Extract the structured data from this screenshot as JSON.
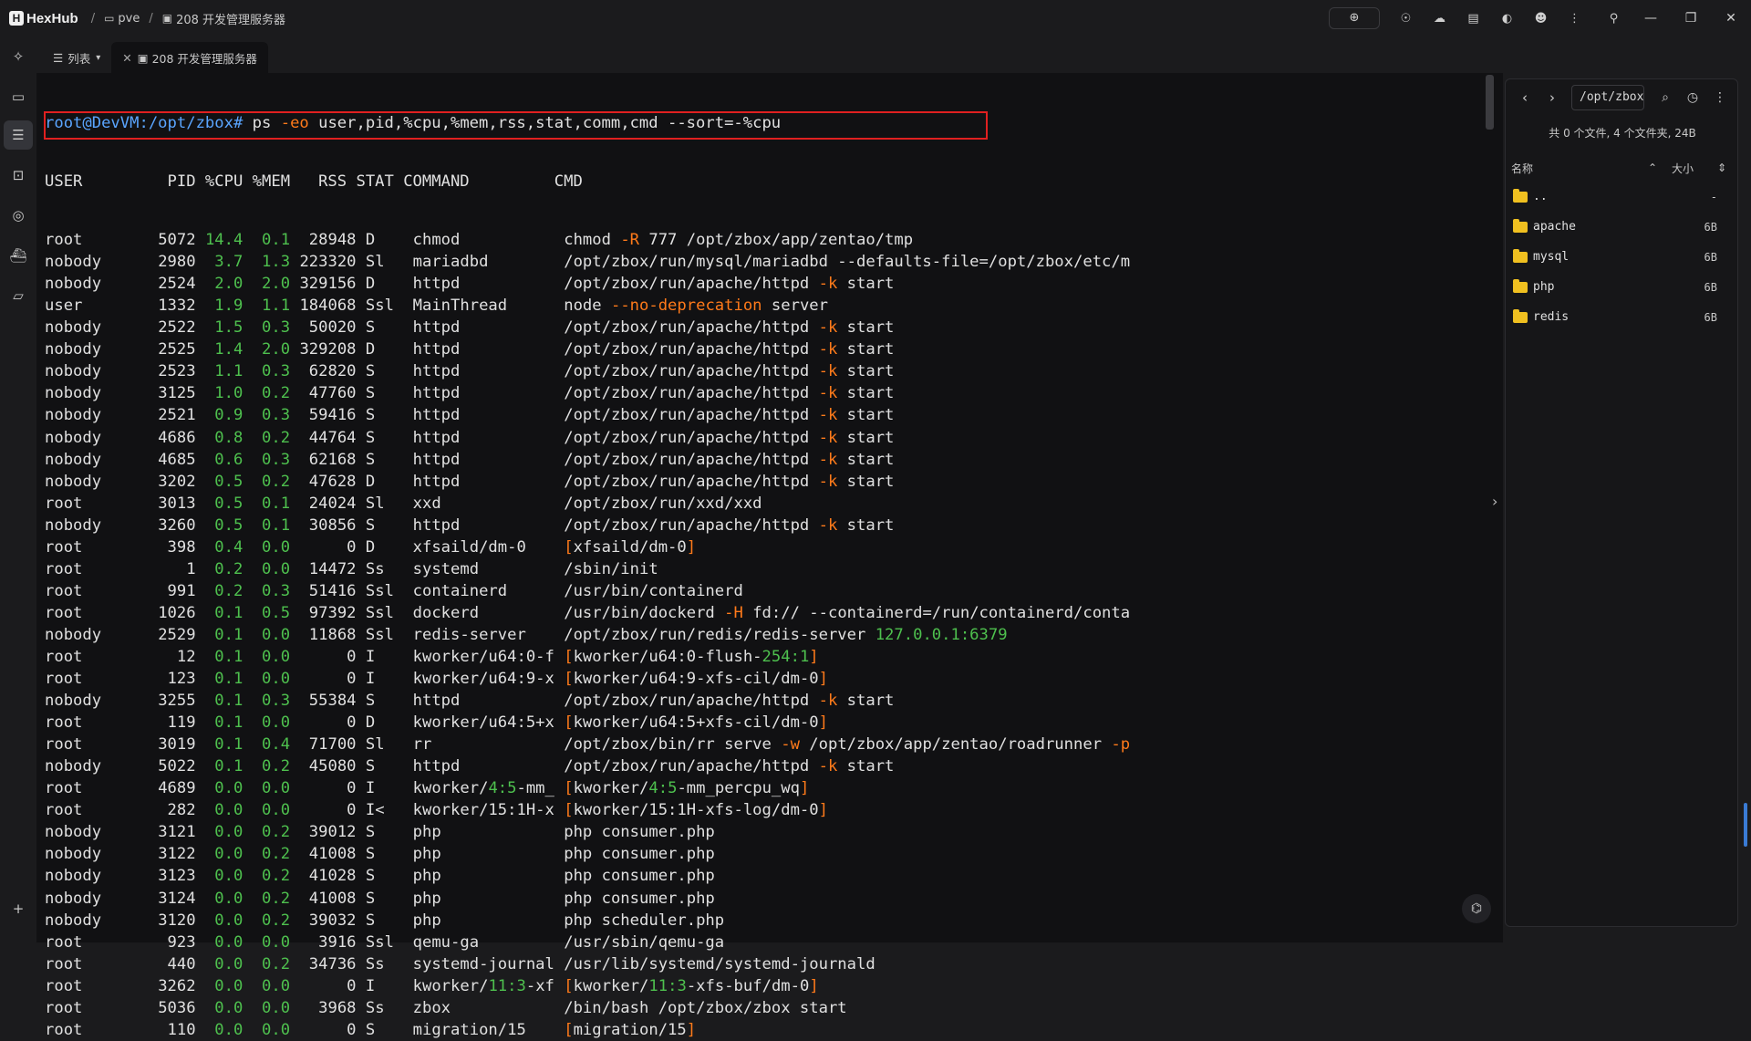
{
  "app": {
    "name": "HexHub",
    "logo_letter": "H"
  },
  "breadcrumb": {
    "sep1": "/",
    "host": "pve",
    "sep2": "/",
    "server": "208 开发管理服务器"
  },
  "tabs": {
    "list_label": "列表",
    "session_label": "208 开发管理服务器"
  },
  "terminal": {
    "prompt": "root@DevVM:/opt/zbox#",
    "command": " ps -eo user,pid,%cpu,%mem,rss,stat,comm,cmd --sort=-%cpu",
    "header": "USER         PID %CPU %MEM   RSS STAT COMMAND         CMD",
    "rows": [
      {
        "pre": "root        ",
        "pid": "5072",
        "cpu": "14.4",
        "mem": "0.1",
        "rss": "28948",
        "stat": "D   ",
        "comm": "chmod          ",
        "cmd": [
          [
            "chmod ",
            ""
          ],
          [
            "-R",
            "opt"
          ],
          [
            " 777 /opt/zbox/app/zentao/tmp",
            ""
          ]
        ]
      },
      {
        "pre": "nobody      ",
        "pid": "2980",
        "cpu": "3.7",
        "mem": "1.3",
        "rss": "223320",
        "stat": "Sl  ",
        "comm": "mariadbd       ",
        "cmd": [
          [
            "/opt/zbox/run/mysql/mariadbd --defaults-file=/opt/zbox/etc/m",
            ""
          ]
        ]
      },
      {
        "pre": "nobody      ",
        "pid": "2524",
        "cpu": "2.0",
        "mem": "2.0",
        "rss": "329156",
        "stat": "D   ",
        "comm": "httpd          ",
        "cmd": [
          [
            "/opt/zbox/run/apache/httpd ",
            ""
          ],
          [
            "-k",
            "opt"
          ],
          [
            " start",
            ""
          ]
        ]
      },
      {
        "pre": "user        ",
        "pid": "1332",
        "cpu": "1.9",
        "mem": "1.1",
        "rss": "184068",
        "stat": "Ssl ",
        "comm": "MainThread     ",
        "cmd": [
          [
            "node ",
            ""
          ],
          [
            "--no-deprecation",
            "opt"
          ],
          [
            " server",
            ""
          ]
        ]
      },
      {
        "pre": "nobody      ",
        "pid": "2522",
        "cpu": "1.5",
        "mem": "0.3",
        "rss": "50020",
        "stat": "S   ",
        "comm": "httpd          ",
        "cmd": [
          [
            "/opt/zbox/run/apache/httpd ",
            ""
          ],
          [
            "-k",
            "opt"
          ],
          [
            " start",
            ""
          ]
        ]
      },
      {
        "pre": "nobody      ",
        "pid": "2525",
        "cpu": "1.4",
        "mem": "2.0",
        "rss": "329208",
        "stat": "D   ",
        "comm": "httpd          ",
        "cmd": [
          [
            "/opt/zbox/run/apache/httpd ",
            ""
          ],
          [
            "-k",
            "opt"
          ],
          [
            " start",
            ""
          ]
        ]
      },
      {
        "pre": "nobody      ",
        "pid": "2523",
        "cpu": "1.1",
        "mem": "0.3",
        "rss": "62820",
        "stat": "S   ",
        "comm": "httpd          ",
        "cmd": [
          [
            "/opt/zbox/run/apache/httpd ",
            ""
          ],
          [
            "-k",
            "opt"
          ],
          [
            " start",
            ""
          ]
        ]
      },
      {
        "pre": "nobody      ",
        "pid": "3125",
        "cpu": "1.0",
        "mem": "0.2",
        "rss": "47760",
        "stat": "S   ",
        "comm": "httpd          ",
        "cmd": [
          [
            "/opt/zbox/run/apache/httpd ",
            ""
          ],
          [
            "-k",
            "opt"
          ],
          [
            " start",
            ""
          ]
        ]
      },
      {
        "pre": "nobody      ",
        "pid": "2521",
        "cpu": "0.9",
        "mem": "0.3",
        "rss": "59416",
        "stat": "S   ",
        "comm": "httpd          ",
        "cmd": [
          [
            "/opt/zbox/run/apache/httpd ",
            ""
          ],
          [
            "-k",
            "opt"
          ],
          [
            " start",
            ""
          ]
        ]
      },
      {
        "pre": "nobody      ",
        "pid": "4686",
        "cpu": "0.8",
        "mem": "0.2",
        "rss": "44764",
        "stat": "S   ",
        "comm": "httpd          ",
        "cmd": [
          [
            "/opt/zbox/run/apache/httpd ",
            ""
          ],
          [
            "-k",
            "opt"
          ],
          [
            " start",
            ""
          ]
        ]
      },
      {
        "pre": "nobody      ",
        "pid": "4685",
        "cpu": "0.6",
        "mem": "0.3",
        "rss": "62168",
        "stat": "S   ",
        "comm": "httpd          ",
        "cmd": [
          [
            "/opt/zbox/run/apache/httpd ",
            ""
          ],
          [
            "-k",
            "opt"
          ],
          [
            " start",
            ""
          ]
        ]
      },
      {
        "pre": "nobody      ",
        "pid": "3202",
        "cpu": "0.5",
        "mem": "0.2",
        "rss": "47628",
        "stat": "D   ",
        "comm": "httpd          ",
        "cmd": [
          [
            "/opt/zbox/run/apache/httpd ",
            ""
          ],
          [
            "-k",
            "opt"
          ],
          [
            " start",
            ""
          ]
        ]
      },
      {
        "pre": "root        ",
        "pid": "3013",
        "cpu": "0.5",
        "mem": "0.1",
        "rss": "24024",
        "stat": "Sl  ",
        "comm": "xxd            ",
        "cmd": [
          [
            "/opt/zbox/run/xxd/xxd",
            ""
          ]
        ]
      },
      {
        "pre": "nobody      ",
        "pid": "3260",
        "cpu": "0.5",
        "mem": "0.1",
        "rss": "30856",
        "stat": "S   ",
        "comm": "httpd          ",
        "cmd": [
          [
            "/opt/zbox/run/apache/httpd ",
            ""
          ],
          [
            "-k",
            "opt"
          ],
          [
            " start",
            ""
          ]
        ]
      },
      {
        "pre": "root        ",
        "pid": "398",
        "cpu": "0.4",
        "mem": "0.0",
        "rss": "0",
        "stat": "D   ",
        "comm": "xfsaild/dm-0   ",
        "cmd": [
          [
            "[",
            "opt"
          ],
          [
            "xfsaild/dm-0",
            ""
          ],
          [
            "]",
            "opt"
          ]
        ]
      },
      {
        "pre": "root        ",
        "pid": "1",
        "cpu": "0.2",
        "mem": "0.0",
        "rss": "14472",
        "stat": "Ss  ",
        "comm": "systemd        ",
        "cmd": [
          [
            "/sbin/init",
            ""
          ]
        ]
      },
      {
        "pre": "root        ",
        "pid": "991",
        "cpu": "0.2",
        "mem": "0.3",
        "rss": "51416",
        "stat": "Ssl ",
        "comm": "containerd     ",
        "cmd": [
          [
            "/usr/bin/containerd",
            ""
          ]
        ]
      },
      {
        "pre": "root        ",
        "pid": "1026",
        "cpu": "0.1",
        "mem": "0.5",
        "rss": "97392",
        "stat": "Ssl ",
        "comm": "dockerd        ",
        "cmd": [
          [
            "/usr/bin/dockerd ",
            ""
          ],
          [
            "-H",
            "opt"
          ],
          [
            " fd:// --containerd=/run/containerd/conta",
            ""
          ]
        ]
      },
      {
        "pre": "nobody      ",
        "pid": "2529",
        "cpu": "0.1",
        "mem": "0.0",
        "rss": "11868",
        "stat": "Ssl ",
        "comm": "redis-server   ",
        "cmd": [
          [
            "/opt/zbox/run/redis/redis-server ",
            ""
          ],
          [
            "127.0.0.1:6379",
            "num"
          ]
        ]
      },
      {
        "pre": "root        ",
        "pid": "12",
        "cpu": "0.1",
        "mem": "0.0",
        "rss": "0",
        "stat": "I   ",
        "comm": "kworker/u64:0-f",
        "cmd": [
          [
            "[",
            "opt"
          ],
          [
            "kworker/u64:0-flush-",
            ""
          ],
          [
            "254:1",
            "num"
          ],
          [
            "]",
            "opt"
          ]
        ]
      },
      {
        "pre": "root        ",
        "pid": "123",
        "cpu": "0.1",
        "mem": "0.0",
        "rss": "0",
        "stat": "I   ",
        "comm": "kworker/u64:9-x",
        "cmd": [
          [
            "[",
            "opt"
          ],
          [
            "kworker/u64:9-xfs-cil/dm-0",
            ""
          ],
          [
            "]",
            "opt"
          ]
        ]
      },
      {
        "pre": "nobody      ",
        "pid": "3255",
        "cpu": "0.1",
        "mem": "0.3",
        "rss": "55384",
        "stat": "S   ",
        "comm": "httpd          ",
        "cmd": [
          [
            "/opt/zbox/run/apache/httpd ",
            ""
          ],
          [
            "-k",
            "opt"
          ],
          [
            " start",
            ""
          ]
        ]
      },
      {
        "pre": "root        ",
        "pid": "119",
        "cpu": "0.1",
        "mem": "0.0",
        "rss": "0",
        "stat": "D   ",
        "comm": "kworker/u64:5+x",
        "cmd": [
          [
            "[",
            "opt"
          ],
          [
            "kworker/u64:5+xfs-cil/dm-0",
            ""
          ],
          [
            "]",
            "opt"
          ]
        ]
      },
      {
        "pre": "root        ",
        "pid": "3019",
        "cpu": "0.1",
        "mem": "0.4",
        "rss": "71700",
        "stat": "Sl  ",
        "comm": "rr             ",
        "cmd": [
          [
            "/opt/zbox/bin/rr serve ",
            ""
          ],
          [
            "-w",
            "opt"
          ],
          [
            " /opt/zbox/app/zentao/roadrunner ",
            ""
          ],
          [
            "-p",
            "opt"
          ]
        ]
      },
      {
        "pre": "nobody      ",
        "pid": "5022",
        "cpu": "0.1",
        "mem": "0.2",
        "rss": "45080",
        "stat": "S   ",
        "comm": "httpd          ",
        "cmd": [
          [
            "/opt/zbox/run/apache/httpd ",
            ""
          ],
          [
            "-k",
            "opt"
          ],
          [
            " start",
            ""
          ]
        ]
      },
      {
        "pre": "root        ",
        "pid": "4689",
        "cpu": "0.0",
        "mem": "0.0",
        "rss": "0",
        "stat": "I   ",
        "comm": "kworker/4:5-mm_",
        "comm_num": "4:5",
        "cmd": [
          [
            "[",
            "opt"
          ],
          [
            "kworker/",
            ""
          ],
          [
            "4:5",
            "num"
          ],
          [
            "-mm_percpu_wq",
            ""
          ],
          [
            "]",
            "opt"
          ]
        ]
      },
      {
        "pre": "root        ",
        "pid": "282",
        "cpu": "0.0",
        "mem": "0.0",
        "rss": "0",
        "stat": "I<  ",
        "comm": "kworker/15:1H-x",
        "cmd": [
          [
            "[",
            "opt"
          ],
          [
            "kworker/15:1H-xfs-log/dm-0",
            ""
          ],
          [
            "]",
            "opt"
          ]
        ]
      },
      {
        "pre": "nobody      ",
        "pid": "3121",
        "cpu": "0.0",
        "mem": "0.2",
        "rss": "39012",
        "stat": "S   ",
        "comm": "php            ",
        "cmd": [
          [
            "php consumer.php",
            ""
          ]
        ]
      },
      {
        "pre": "nobody      ",
        "pid": "3122",
        "cpu": "0.0",
        "mem": "0.2",
        "rss": "41008",
        "stat": "S   ",
        "comm": "php            ",
        "cmd": [
          [
            "php consumer.php",
            ""
          ]
        ]
      },
      {
        "pre": "nobody      ",
        "pid": "3123",
        "cpu": "0.0",
        "mem": "0.2",
        "rss": "41028",
        "stat": "S   ",
        "comm": "php            ",
        "cmd": [
          [
            "php consumer.php",
            ""
          ]
        ]
      },
      {
        "pre": "nobody      ",
        "pid": "3124",
        "cpu": "0.0",
        "mem": "0.2",
        "rss": "41008",
        "stat": "S   ",
        "comm": "php            ",
        "cmd": [
          [
            "php consumer.php",
            ""
          ]
        ]
      },
      {
        "pre": "nobody      ",
        "pid": "3120",
        "cpu": "0.0",
        "mem": "0.2",
        "rss": "39032",
        "stat": "S   ",
        "comm": "php            ",
        "cmd": [
          [
            "php scheduler.php",
            ""
          ]
        ]
      },
      {
        "pre": "root        ",
        "pid": "923",
        "cpu": "0.0",
        "mem": "0.0",
        "rss": "3916",
        "stat": "Ssl ",
        "comm": "qemu-ga        ",
        "cmd": [
          [
            "/usr/sbin/qemu-ga",
            ""
          ]
        ]
      },
      {
        "pre": "root        ",
        "pid": "440",
        "cpu": "0.0",
        "mem": "0.2",
        "rss": "34736",
        "stat": "Ss  ",
        "comm": "systemd-journal",
        "cmd": [
          [
            "/usr/lib/systemd/systemd-journald",
            ""
          ]
        ]
      },
      {
        "pre": "root        ",
        "pid": "3262",
        "cpu": "0.0",
        "mem": "0.0",
        "rss": "0",
        "stat": "I   ",
        "comm": "kworker/11:3-xf",
        "comm_num": "11:3",
        "cmd": [
          [
            "[",
            "opt"
          ],
          [
            "kworker/",
            ""
          ],
          [
            "11:3",
            "num"
          ],
          [
            "-xfs-buf/dm-0",
            ""
          ],
          [
            "]",
            "opt"
          ]
        ]
      },
      {
        "pre": "root        ",
        "pid": "5036",
        "cpu": "0.0",
        "mem": "0.0",
        "rss": "3968",
        "stat": "Ss  ",
        "comm": "zbox           ",
        "cmd": [
          [
            "/bin/bash /opt/zbox/zbox start",
            ""
          ]
        ]
      },
      {
        "pre": "root        ",
        "pid": "110",
        "cpu": "0.0",
        "mem": "0.0",
        "rss": "0",
        "stat": "S   ",
        "comm": "migration/15   ",
        "cmd": [
          [
            "[",
            "opt"
          ],
          [
            "migration/15",
            ""
          ],
          [
            "]",
            "opt"
          ]
        ]
      }
    ]
  },
  "sidebar": {
    "path": "/opt/zbox",
    "summary": "共 0 个文件, 4 个文件夹, 24B",
    "col_name": "名称",
    "col_size": "大小",
    "files": [
      {
        "name": "..",
        "size": "-"
      },
      {
        "name": "apache",
        "size": "6B"
      },
      {
        "name": "mysql",
        "size": "6B"
      },
      {
        "name": "php",
        "size": "6B"
      },
      {
        "name": "redis",
        "size": "6B"
      }
    ]
  },
  "colors": {
    "prompt": "#5aa5ff",
    "option": "#ff7a1a",
    "number": "#4ec04e",
    "highlight": "#e02020",
    "folder": "#f0c020"
  }
}
